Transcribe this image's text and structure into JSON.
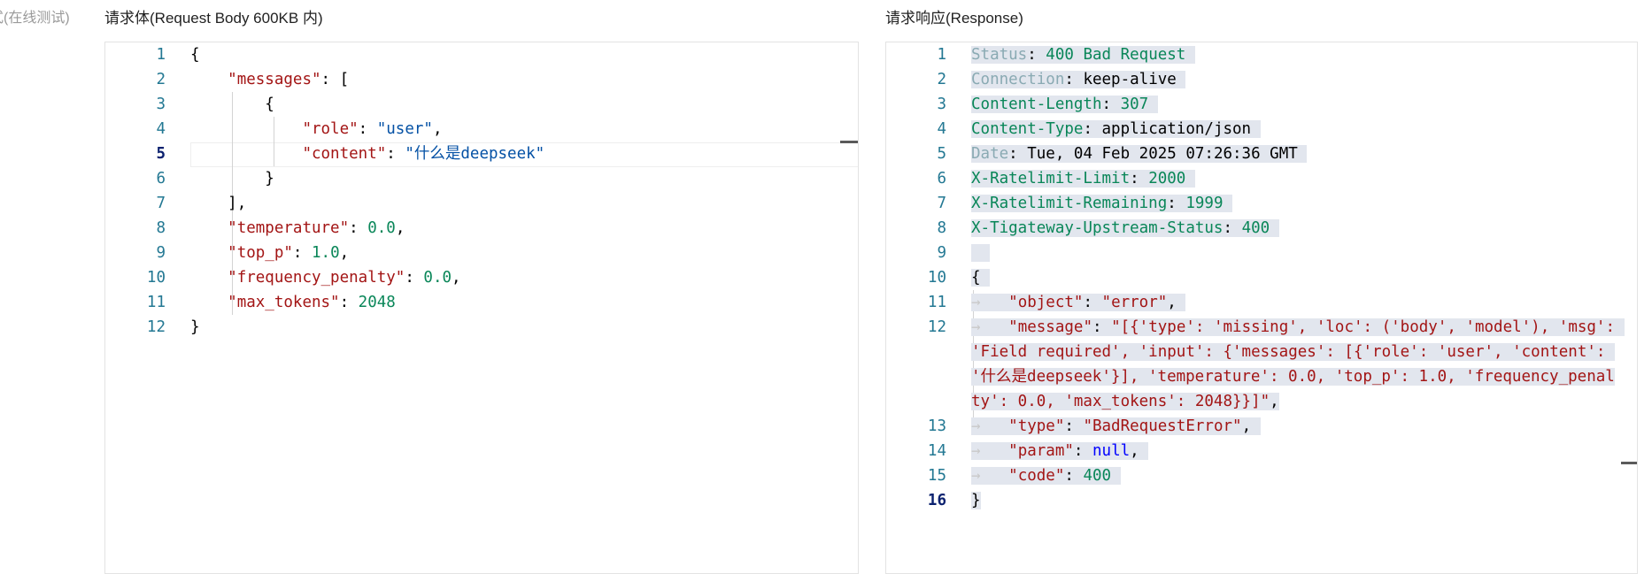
{
  "left_label": "式(在线测试)",
  "request": {
    "title": "请求体(Request Body 600KB 内)",
    "line_numbers": [
      "1",
      "2",
      "3",
      "4",
      "5",
      "6",
      "7",
      "8",
      "9",
      "10",
      "11",
      "12"
    ],
    "active_line": "5",
    "code": {
      "messages_key": "\"messages\"",
      "role_key": "\"role\"",
      "role_val": "\"user\"",
      "content_key": "\"content\"",
      "content_val": "\"什么是deepseek\"",
      "temperature_key": "\"temperature\"",
      "temperature_val": "0.0",
      "top_p_key": "\"top_p\"",
      "top_p_val": "1.0",
      "frequency_penalty_key": "\"frequency_penalty\"",
      "frequency_penalty_val": "0.0",
      "max_tokens_key": "\"max_tokens\"",
      "max_tokens_val": "2048"
    }
  },
  "response": {
    "title": "请求响应(Response)",
    "line_numbers": [
      "1",
      "2",
      "3",
      "4",
      "5",
      "6",
      "7",
      "8",
      "9",
      "10",
      "11",
      "12",
      "13",
      "14",
      "15",
      "16"
    ],
    "active_line": "16",
    "headers": {
      "status_name": "Status",
      "status_value": "400 Bad Request",
      "connection_name": "Connection",
      "connection_value": "keep-alive",
      "content_length_name": "Content-Length",
      "content_length_value": "307",
      "content_type_name": "Content-Type",
      "content_type_value": "application/json",
      "date_name": "Date",
      "date_value": "Tue, 04 Feb 2025 07:26:36 GMT",
      "ratelimit_limit_name": "X-Ratelimit-Limit",
      "ratelimit_limit_value": "2000",
      "ratelimit_remaining_name": "X-Ratelimit-Remaining",
      "ratelimit_remaining_value": "1999",
      "upstream_status_name": "X-Tigateway-Upstream-Status",
      "upstream_status_value": "400"
    },
    "body": {
      "object_key": "\"object\"",
      "object_val": "\"error\"",
      "message_key": "\"message\"",
      "message_val": "\"[{'type': 'missing', 'loc': ('body', 'model'), 'msg': 'Field required', 'input': {'messages': [{'role': 'user', 'content': '什么是deepseek'}], 'temperature': 0.0, 'top_p': 1.0, 'frequency_penalty': 0.0, 'max_tokens': 2048}}]\"",
      "type_key": "\"type\"",
      "type_val": "\"BadRequestError\"",
      "param_key": "\"param\"",
      "param_val": "null",
      "code_key": "\"code\"",
      "code_val": "400"
    }
  }
}
